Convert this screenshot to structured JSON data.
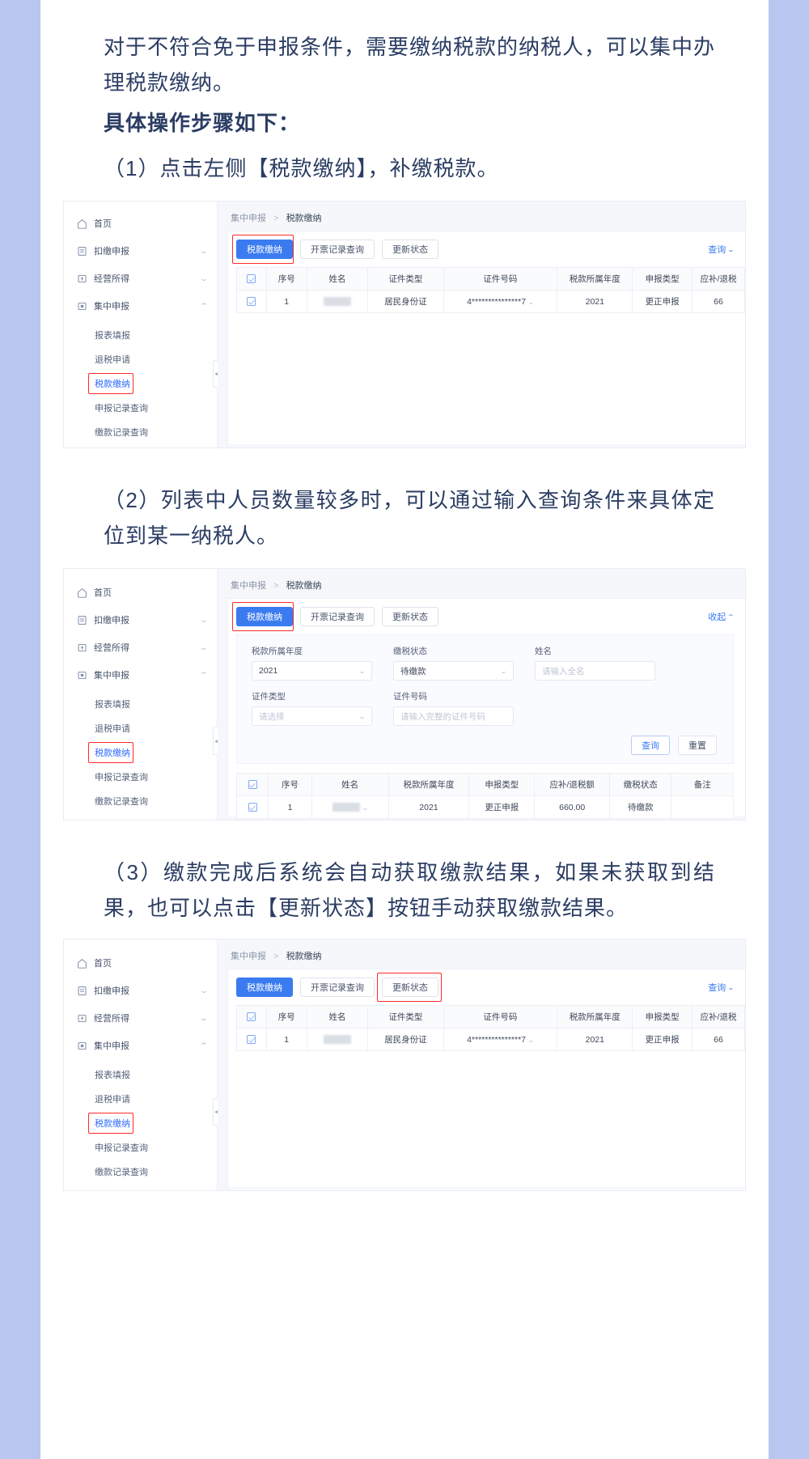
{
  "doc": {
    "paragraphs": [
      {
        "id": "p1",
        "text": "对于不符合免于申报条件，需要缴纳税款的纳税人，可以集中办理税款缴纳。",
        "bold": false
      },
      {
        "id": "p2",
        "text": "具体操作步骤如下：",
        "bold": true
      },
      {
        "id": "step1",
        "text": "（1）点击左侧【税款缴纳】，补缴税款。",
        "bold": false
      },
      {
        "id": "step2",
        "text": "（2）列表中人员数量较多时，可以通过输入查询条件来具体定位到某一纳税人。",
        "bold": false
      },
      {
        "id": "step3",
        "text": "（3）缴款完成后系统会自动获取缴款结果，如果未获取到结果，也可以点击【更新状态】按钮手动获取缴款结果。",
        "bold": false
      }
    ]
  },
  "sidebar": {
    "items": [
      {
        "label": "首页",
        "icon": "home-icon",
        "caret": ""
      },
      {
        "label": "扣缴申报",
        "icon": "form-icon",
        "caret": "⌄"
      },
      {
        "label": "经营所得",
        "icon": "business-icon",
        "caret": "⌄"
      },
      {
        "label": "集中申报",
        "icon": "batch-icon",
        "caret": "⌃"
      }
    ],
    "subitems": [
      {
        "label": "报表填报",
        "active": false
      },
      {
        "label": "退税申请",
        "active": false
      },
      {
        "label": "税款缴纳",
        "active": true
      },
      {
        "label": "申报记录查询",
        "active": false
      },
      {
        "label": "缴款记录查询",
        "active": false
      }
    ],
    "collapse_handle": "◀"
  },
  "breadcrumb": {
    "parent": "集中申报",
    "separator": ">",
    "current": "税款缴纳"
  },
  "toolbar": {
    "tax_payment": "税款缴纳",
    "invoice_record_query": "开票记录查询",
    "update_status": "更新状态",
    "query_toggle_expand": "查询",
    "query_toggle_collapse": "收起",
    "caret_down": "⌄",
    "caret_up": "⌃"
  },
  "table_full": {
    "headers": [
      "",
      "序号",
      "姓名",
      "证件类型",
      "证件号码",
      "税款所属年度",
      "申报类型",
      "应补/退税"
    ],
    "rows": [
      {
        "seq": "1",
        "name": "",
        "id_type": "居民身份证",
        "id_number": "4***************7",
        "tax_year": "2021",
        "declare_type": "更正申报",
        "amount": "66"
      }
    ]
  },
  "search_form": {
    "fields": [
      {
        "label": "税款所属年度",
        "value": "2021",
        "placeholder": "",
        "type": "select"
      },
      {
        "label": "缴税状态",
        "value": "待缴款",
        "placeholder": "",
        "type": "select"
      },
      {
        "label": "姓名",
        "value": "",
        "placeholder": "请输入全名",
        "type": "input"
      },
      {
        "label": "证件类型",
        "value": "",
        "placeholder": "请选择",
        "type": "select"
      },
      {
        "label": "证件号码",
        "value": "",
        "placeholder": "请输入完整的证件号码",
        "type": "input"
      }
    ],
    "query_button": "查询",
    "reset_button": "重置"
  },
  "table_compact": {
    "headers": [
      "",
      "序号",
      "姓名",
      "税款所属年度",
      "申报类型",
      "应补/退税额",
      "缴税状态",
      "备注"
    ],
    "rows": [
      {
        "seq": "1",
        "name": "",
        "tax_year": "2021",
        "declare_type": "更正申报",
        "amount": "660.00",
        "pay_status": "待缴款",
        "remark": ""
      }
    ]
  },
  "colors": {
    "page_bg": "#b9c6f0",
    "text": "#2b3d63",
    "primary": "#3a7bf0",
    "highlight": "#ff2a2a"
  }
}
